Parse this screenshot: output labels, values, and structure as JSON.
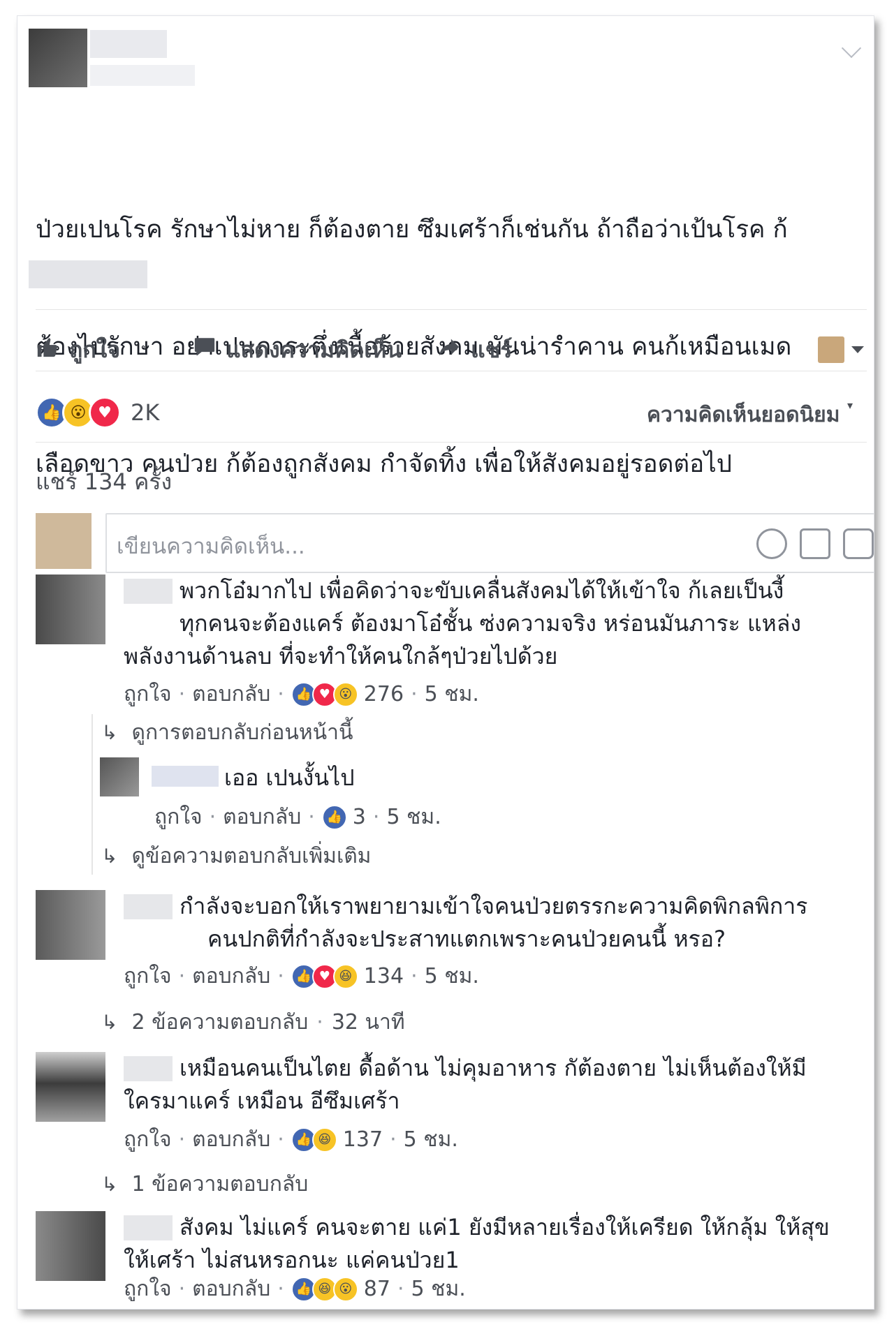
{
  "post": {
    "text_lines": [
      "ป่วยเปนโรค รักษาไม่หาย ก็ต้องตาย ซึมเศร้าก็เช่นกัน ถ้าถือว่าเป้นโรค ก้",
      "ต้องไปรักษา อย่าเปนภาระตึ่งเนื้อร้ายสังคม มันน่ารำคาน คนก้เหมือนเมด",
      "เลือดขาว คนป่วย ก้ต้องถูกสังคม กำจัดทิ้ง เพื่อให้สังคมอยู่รอดต่อไป"
    ]
  },
  "actions": {
    "like": "ถูกใจ",
    "comment": "แสดงความคิดเห็น",
    "share": "แชร์"
  },
  "reactions": {
    "count": "2K",
    "top_comments": "ความคิดเห็นยอดนิยม"
  },
  "shares": "แชร์ 134 ครั้ง",
  "composer": {
    "placeholder": "เขียนความคิดเห็น..."
  },
  "comments": [
    {
      "lines": [
        "พวกโอ๋มากไป เพื่อคิดว่าจะขับเคลื่นสังคมได้ให้เข้าใจ ก้เลยเป็นงี้",
        "ทุกคนจะต้องแคร์ ต้องมาโอ๋ชั้น ซ่งความจริง หร่อนมันภาระ แหล่ง",
        "พลังงานด้านลบ ที่จะทำให้คนใกล้ๆป่วยไปด้วย"
      ],
      "like": "ถูกใจ",
      "reply": "ตอบกลับ",
      "reaction_count": "276",
      "time": "5 ชม.",
      "prev_replies": "ดูการตอบกลับก่อนหน้านี้",
      "reply_item": {
        "text": "เออ เปนงั้นไป",
        "like": "ถูกใจ",
        "reply": "ตอบกลับ",
        "reaction_count": "3",
        "time": "5 ชม."
      },
      "more_replies": "ดูข้อความตอบกลับเพิ่มเติม"
    },
    {
      "lines": [
        "กำลังจะบอกให้เราพยายามเข้าใจคนป่วยตรรกะความคิดพิกลพิการ",
        "คนปกติที่กำลังจะประสาทแตกเพราะคนป่วยคนนี้ หรอ?"
      ],
      "like": "ถูกใจ",
      "reply": "ตอบกลับ",
      "reaction_count": "134",
      "time": "5 ชม.",
      "replies_link": "2 ข้อความตอบกลับ",
      "replies_time": "32 นาที"
    },
    {
      "lines": [
        "เหมือนคนเป็นไตย ดื้อด้าน ไม่คุมอาหาร กัต้องตาย ไม่เห็นต้องให้มี",
        "ใครมาแคร์ เหมือน อีซึมเศร้า"
      ],
      "like": "ถูกใจ",
      "reply": "ตอบกลับ",
      "reaction_count": "137",
      "time": "5 ชม.",
      "replies_link": "1 ข้อความตอบกลับ"
    },
    {
      "lines": [
        "สังคม ไม่แคร์ คนจะตาย แค่1 ยังมีหลายเรื่องให้เครียด ให้กลุ้ม ให้สุข",
        "ให้เศร้า ไม่สนหรอกนะ แค่คนป่วย1"
      ],
      "like": "ถูกใจ",
      "reply": "ตอบกลับ",
      "reaction_count": "87",
      "time": "5 ชม."
    }
  ],
  "colors": {
    "like_blue": "#4267b2",
    "love_red": "#f0284a",
    "wow_yellow": "#f7c325",
    "text": "#1d2129",
    "secondary": "#4b4f56"
  }
}
